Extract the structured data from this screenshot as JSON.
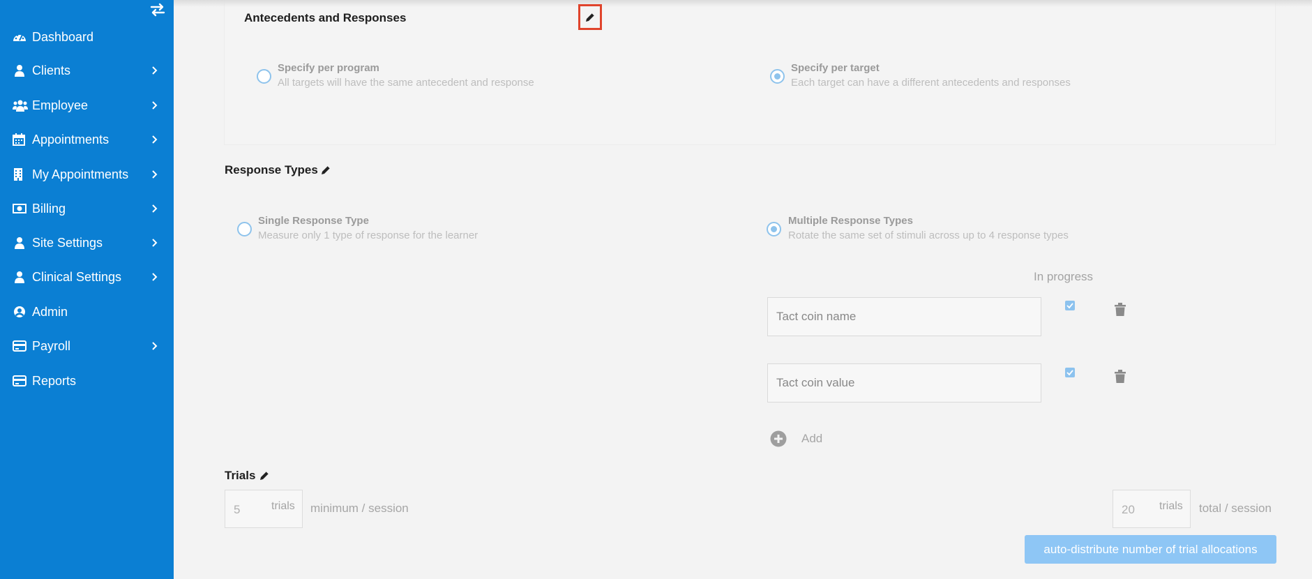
{
  "sidebar": {
    "items": [
      {
        "label": "Dashboard",
        "icon": "dashboard-icon",
        "has_submenu": false
      },
      {
        "label": "Clients",
        "icon": "user-icon",
        "has_submenu": true
      },
      {
        "label": "Employee",
        "icon": "users-icon",
        "has_submenu": true
      },
      {
        "label": "Appointments",
        "icon": "calendar-icon",
        "has_submenu": true
      },
      {
        "label": "My Appointments",
        "icon": "building-icon",
        "has_submenu": true
      },
      {
        "label": "Billing",
        "icon": "money-icon",
        "has_submenu": true
      },
      {
        "label": "Site Settings",
        "icon": "user-icon",
        "has_submenu": true
      },
      {
        "label": "Clinical Settings",
        "icon": "user-icon",
        "has_submenu": true
      },
      {
        "label": "Admin",
        "icon": "user-circle-icon",
        "has_submenu": false
      },
      {
        "label": "Payroll",
        "icon": "credit-card-icon",
        "has_submenu": true
      },
      {
        "label": "Reports",
        "icon": "credit-card-icon",
        "has_submenu": false
      }
    ]
  },
  "antecedents": {
    "title": "Antecedents and Responses",
    "options": [
      {
        "title": "Specify per program",
        "desc": "All targets will have the same antecedent and response",
        "selected": false
      },
      {
        "title": "Specify per target",
        "desc": "Each target can have a different antecedents and responses",
        "selected": true
      }
    ]
  },
  "response_types": {
    "title": "Response Types",
    "options": [
      {
        "title": "Single Response Type",
        "desc": "Measure only 1 type of response for the learner",
        "selected": false
      },
      {
        "title": "Multiple Response Types",
        "desc": "Rotate the same set of stimuli across up to 4 response types",
        "selected": true
      }
    ],
    "in_progress_label": "In progress",
    "rows": [
      {
        "value": "Tact coin name",
        "in_progress": true
      },
      {
        "value": "Tact coin value",
        "in_progress": true
      }
    ],
    "add_label": "Add"
  },
  "trials": {
    "title": "Trials",
    "min_value": "5",
    "min_unit": "trials",
    "min_label": "minimum / session",
    "total_value": "20",
    "total_unit": "trials",
    "total_label": "total / session",
    "auto_button": "auto-distribute number of trial allocations"
  },
  "colors": {
    "sidebar_bg": "#0b7fd3",
    "accent_light": "#8ec6f5",
    "highlight": "#e0442c"
  }
}
